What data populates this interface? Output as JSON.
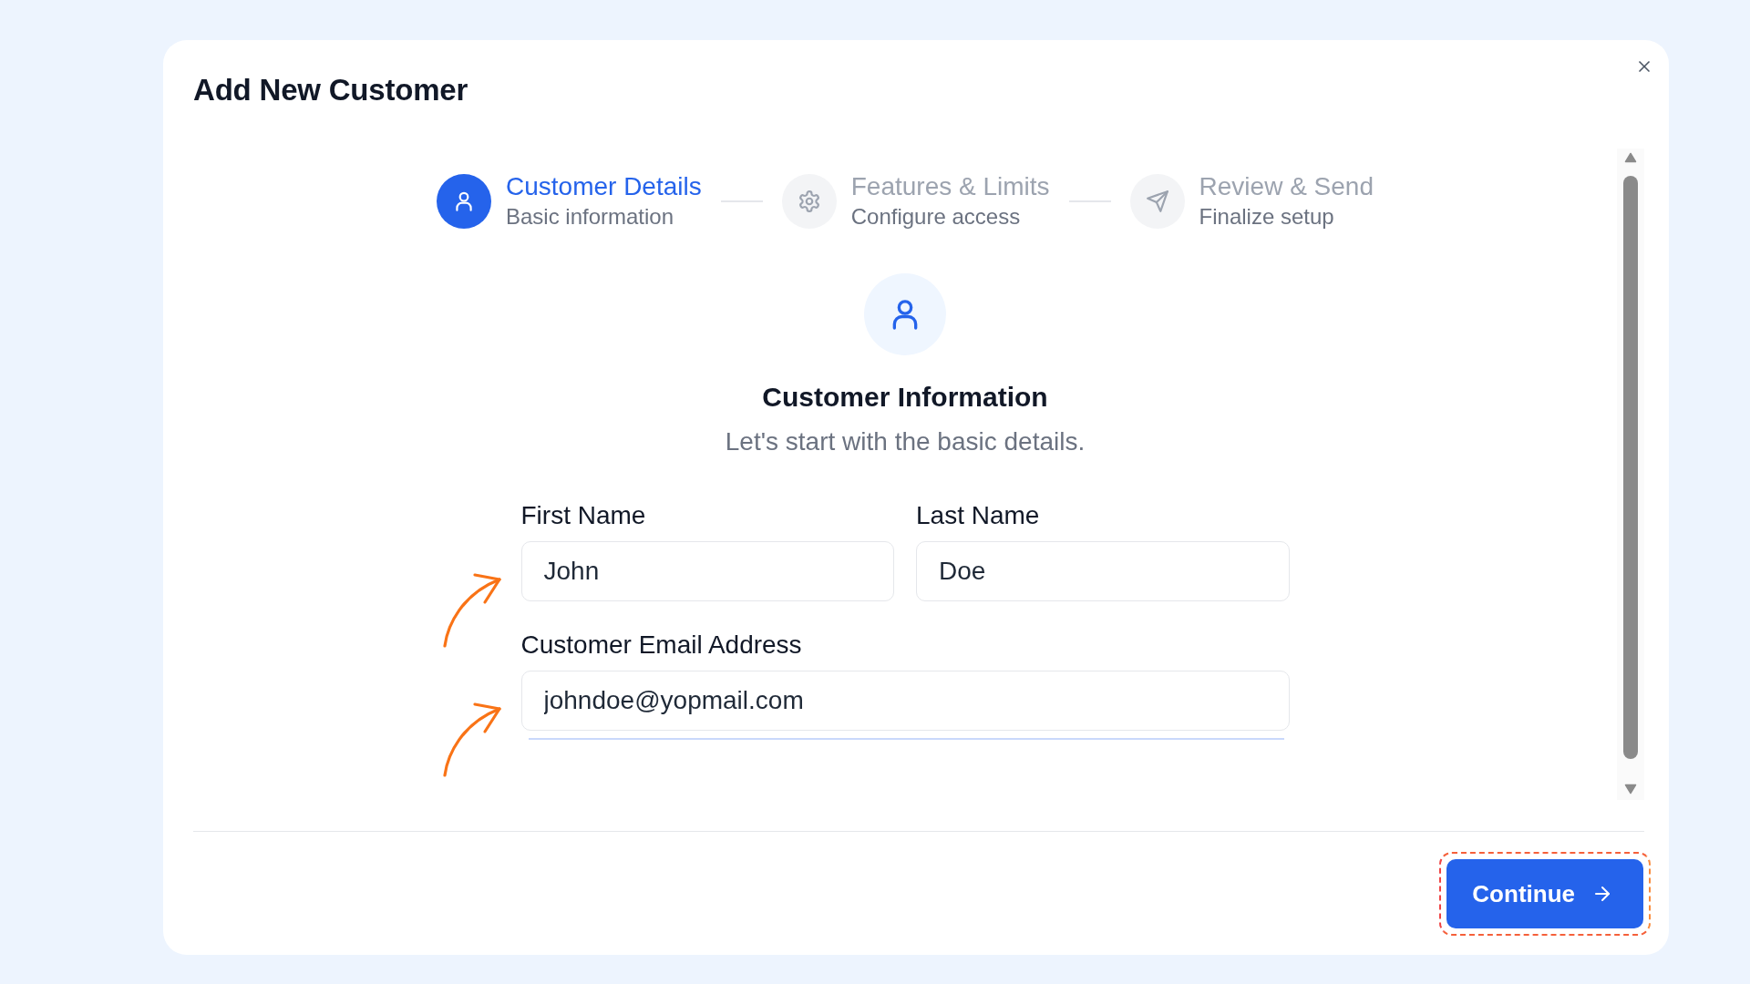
{
  "dialog": {
    "title": "Add New Customer"
  },
  "stepper": {
    "steps": [
      {
        "title": "Customer Details",
        "subtitle": "Basic information",
        "selected": true
      },
      {
        "title": "Features & Limits",
        "subtitle": "Configure access",
        "selected": false
      },
      {
        "title": "Review & Send",
        "subtitle": "Finalize setup",
        "selected": false
      }
    ]
  },
  "section": {
    "title": "Customer Information",
    "subtitle": "Let's start with the basic details."
  },
  "form": {
    "rows": [
      {
        "fields": [
          {
            "label": "First Name",
            "value": "John",
            "annotated": true
          },
          {
            "label": "Last Name",
            "value": "Doe",
            "annotated": false
          }
        ]
      },
      {
        "fields": [
          {
            "label": "Customer Email Address",
            "value": "johndoe@yopmail.com",
            "annotated": true
          }
        ]
      }
    ]
  },
  "footer": {
    "buttons": [
      {
        "label": "Continue",
        "highlighted": true
      }
    ]
  }
}
